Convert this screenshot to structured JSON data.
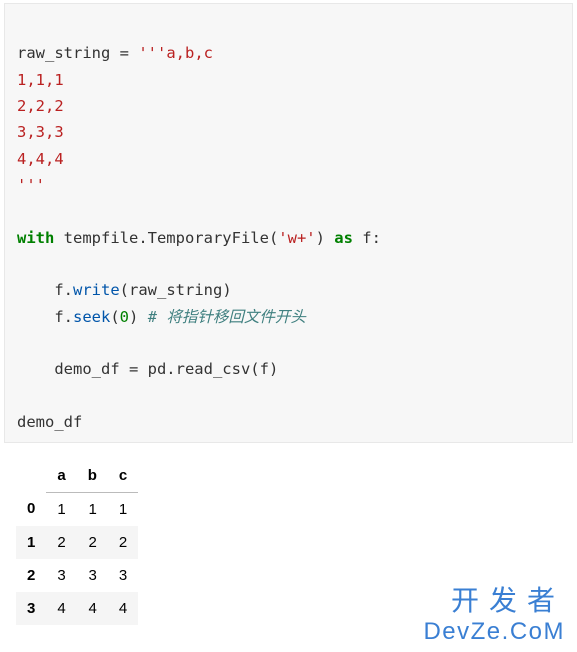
{
  "code": {
    "l1a": "raw_string = ",
    "l1b": "'''a,b,c",
    "l2": "1,1,1",
    "l3": "2,2,2",
    "l4": "3,3,3",
    "l5": "4,4,4",
    "l6": "'''",
    "l8a": "with",
    "l8b": " tempfile.TemporaryFile(",
    "l8c": "'w+'",
    "l8d": ") ",
    "l8e": "as",
    "l8f": " f:",
    "l10a": "    f.",
    "l10b": "write",
    "l10c": "(raw_string)",
    "l11a": "    f.",
    "l11b": "seek",
    "l11c": "(",
    "l11d": "0",
    "l11e": ") ",
    "l11f": "# 将指针移回文件开头",
    "l13": "    demo_df = pd.read_csv(f)",
    "l15": "demo_df"
  },
  "df": {
    "cols": [
      "a",
      "b",
      "c"
    ],
    "index": [
      "0",
      "1",
      "2",
      "3"
    ],
    "rows": [
      [
        "1",
        "1",
        "1"
      ],
      [
        "2",
        "2",
        "2"
      ],
      [
        "3",
        "3",
        "3"
      ],
      [
        "4",
        "4",
        "4"
      ]
    ]
  },
  "watermark": {
    "top": "开发者",
    "bot": "DevZe.CoM"
  }
}
